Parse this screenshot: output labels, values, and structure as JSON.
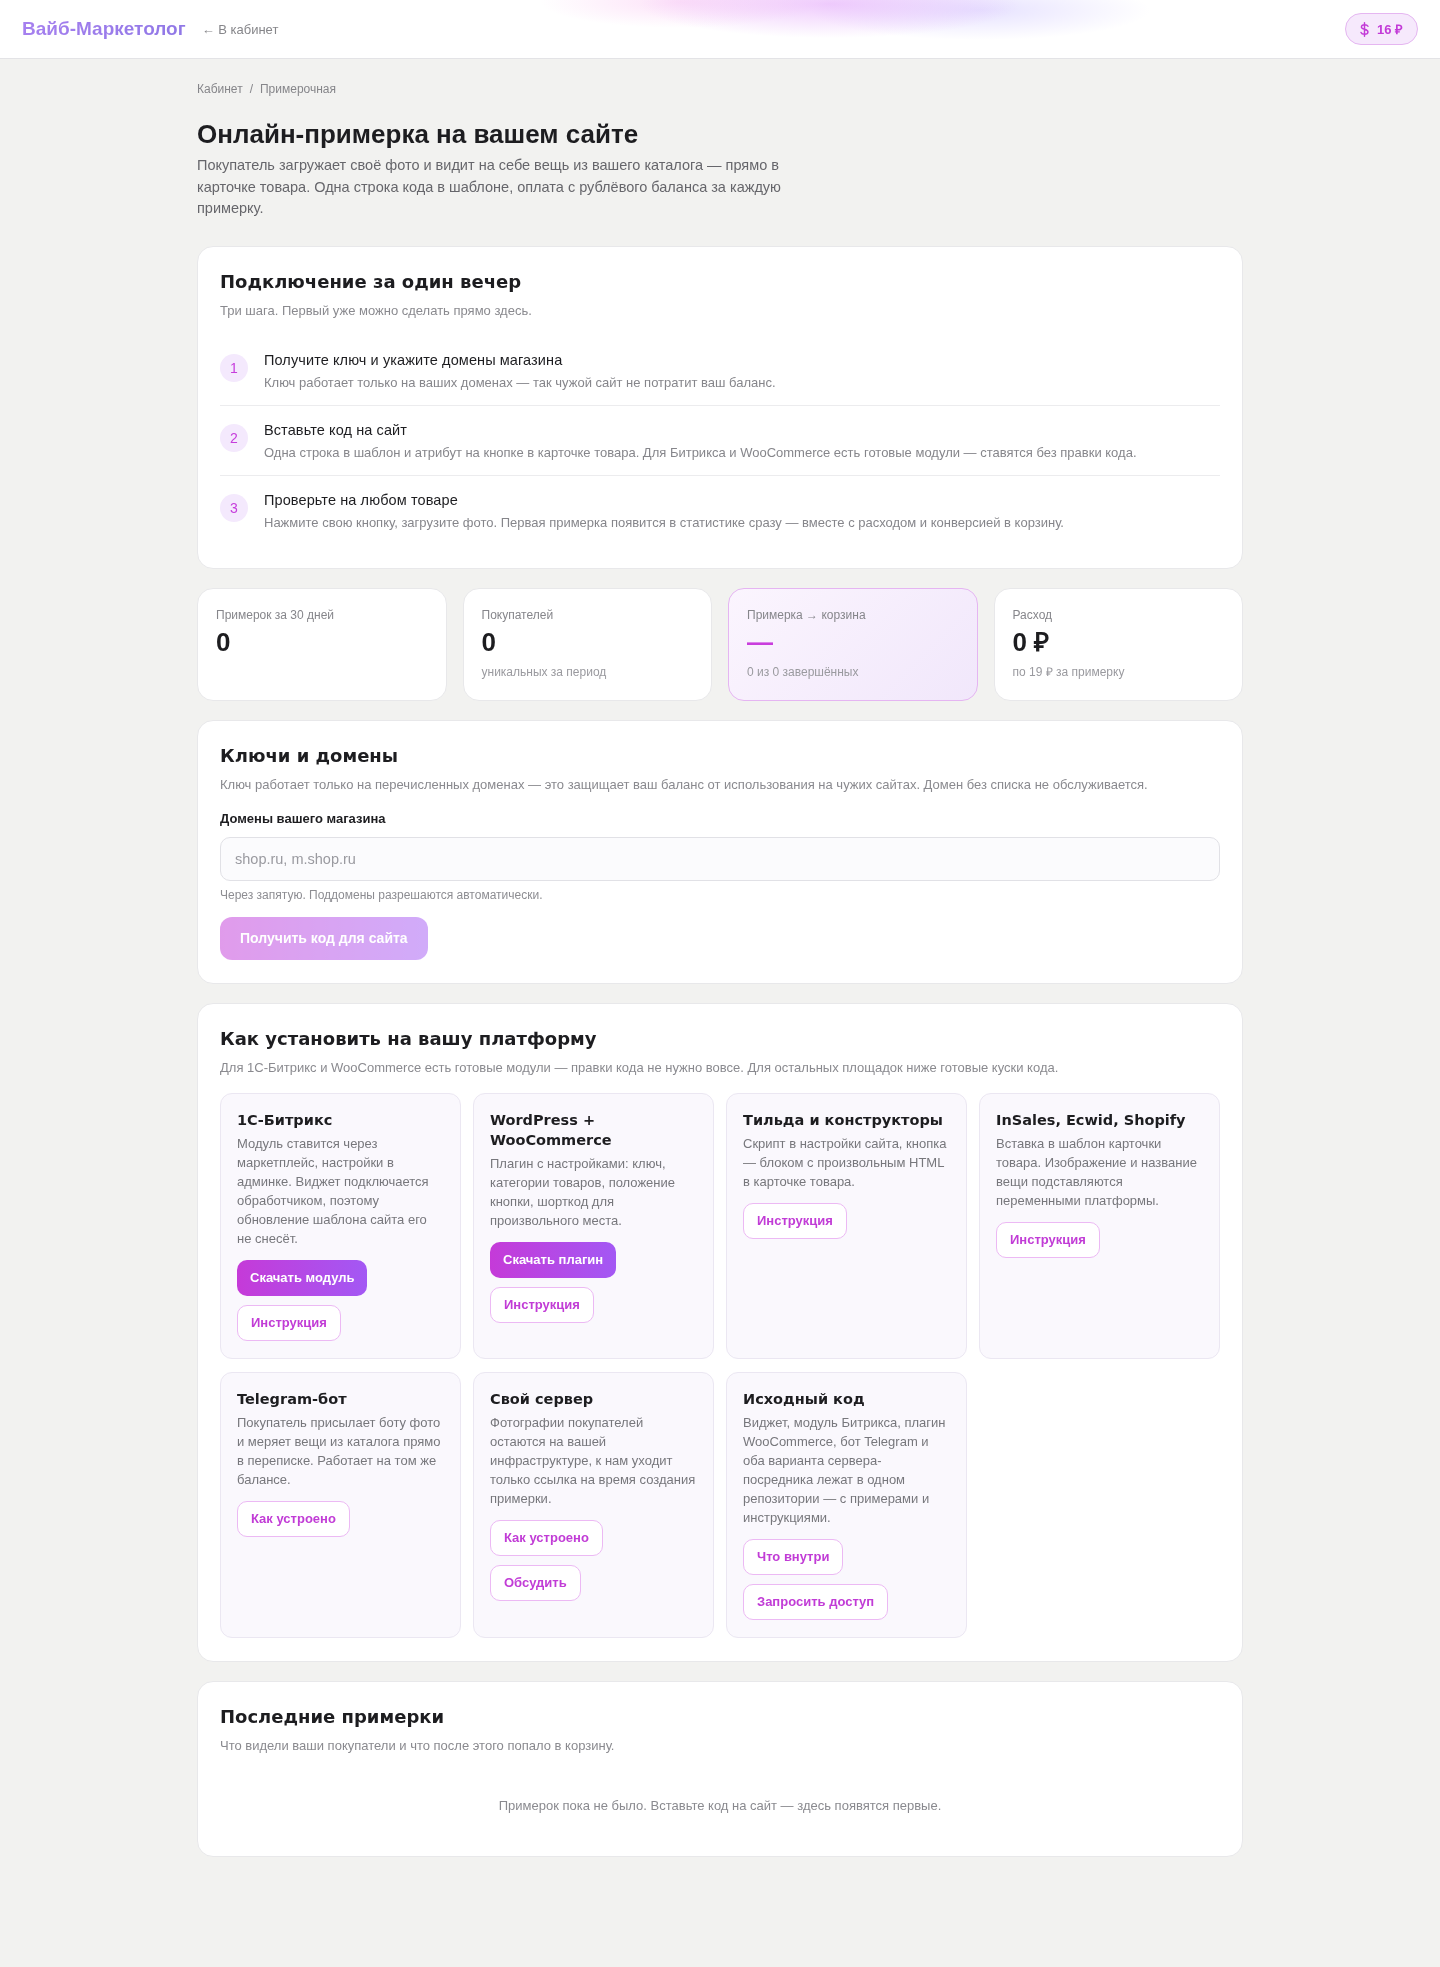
{
  "header": {
    "logo": "Вайб-Маркетолог",
    "back_link": "← В кабинет",
    "balance": "16 ₽"
  },
  "breadcrumb": {
    "items": [
      "Кабинет",
      "Примерочная"
    ],
    "separator": "/"
  },
  "page": {
    "title": "Онлайн-примерка на вашем сайте",
    "description": "Покупатель загружает своё фото и видит на себе вещь из вашего каталога — прямо в карточке товара. Одна строка кода в шаблоне, оплата с рублёвого баланса за каждую примерку."
  },
  "setup": {
    "title": "Подключение за один вечер",
    "subtitle": "Три шага. Первый уже можно сделать прямо здесь.",
    "steps": [
      {
        "number": "1",
        "title": "Получите ключ и укажите домены магазина",
        "text": "Ключ работает только на ваших доменах — так чужой сайт не потратит ваш баланс."
      },
      {
        "number": "2",
        "title": "Вставьте код на сайт",
        "text": "Одна строка в шаблон и атрибут на кнопке в карточке товара. Для Битрикса и WooCommerce есть готовые модули — ставятся без правки кода."
      },
      {
        "number": "3",
        "title": "Проверьте на любом товаре",
        "text": "Нажмите свою кнопку, загрузите фото. Первая примерка появится в статистике сразу — вместе с расходом и конверсией в корзину."
      }
    ]
  },
  "stats": [
    {
      "label": "Примерок за 30 дней",
      "value": "0",
      "highlighted": false
    },
    {
      "label": "Покупателей",
      "value": "0",
      "note": "уникальных за период",
      "highlighted": false
    },
    {
      "label": "Примерка → корзина",
      "value": "—",
      "note": "0 из 0 завершённых",
      "highlighted": true
    },
    {
      "label": "Расход",
      "value": "0 ₽",
      "note": "по 19 ₽ за примерку",
      "highlighted": false
    }
  ],
  "keys": {
    "title": "Ключи и домены",
    "description": "Ключ работает только на перечисленных доменах — это защищает ваш баланс от использования на чужих сайтах. Домен без списка не обслуживается.",
    "field_label": "Домены вашего магазина",
    "field": {
      "placeholder": "shop.ru, m.shop.ru"
    },
    "hint": "Через запятую. Поддомены разрешаются автоматически.",
    "button": {
      "label": "Получить код для сайта",
      "disabled": true
    }
  },
  "platforms": {
    "title": "Как установить на вашу платформу",
    "subtitle": "Для 1С-Битрикс и WooCommerce есть готовые модули — правки кода не нужно вовсе. Для остальных площадок ниже готовые куски кода.",
    "cards": [
      {
        "title": "1С-Битрикс",
        "text": "Модуль ставится через маркетплейс, настройки в админке. Виджет подключается обработчиком, поэтому обновление шаблона сайта его не снесёт.",
        "buttons": [
          {
            "label": "Скачать модуль",
            "kind": "primary"
          },
          {
            "label": "Инструкция",
            "kind": "outline"
          }
        ]
      },
      {
        "title": "WordPress + WooCommerce",
        "text": "Плагин с настройками: ключ, категории товаров, положение кнопки, шорткод для произвольного места.",
        "buttons": [
          {
            "label": "Скачать плагин",
            "kind": "primary"
          },
          {
            "label": "Инструкция",
            "kind": "outline"
          }
        ]
      },
      {
        "title": "Тильда и конструкторы",
        "text": "Скрипт в настройки сайта, кнопка — блоком с произвольным HTML в карточке товара.",
        "buttons": [
          {
            "label": "Инструкция",
            "kind": "outline"
          }
        ]
      },
      {
        "title": "InSales, Ecwid, Shopify",
        "text": "Вставка в шаблон карточки товара. Изображение и название вещи подставляются переменными платформы.",
        "buttons": [
          {
            "label": "Инструкция",
            "kind": "outline"
          }
        ]
      },
      {
        "title": "Telegram-бот",
        "text": "Покупатель присылает боту фото и меряет вещи из каталога прямо в переписке. Работает на том же балансе.",
        "buttons": [
          {
            "label": "Как устроено",
            "kind": "outline"
          }
        ]
      },
      {
        "title": "Свой сервер",
        "text": "Фотографии покупателей остаются на вашей инфраструктуре, к нам уходит только ссылка на время создания примерки.",
        "buttons": [
          {
            "label": "Как устроено",
            "kind": "outline"
          },
          {
            "label": "Обсудить",
            "kind": "outline"
          }
        ]
      },
      {
        "title": "Исходный код",
        "text": "Виджет, модуль Битрикса, плагин WooCommerce, бот Telegram и оба варианта сервера-посредника лежат в одном репозитории — с примерами и инструкциями.",
        "buttons": [
          {
            "label": "Что внутри",
            "kind": "outline"
          },
          {
            "label": "Запросить доступ",
            "kind": "outline"
          }
        ]
      }
    ]
  },
  "recent": {
    "title": "Последние примерки",
    "subtitle": "Что видели ваши покупатели и что после этого попало в корзину.",
    "empty_message": "Примерок пока не было. Вставьте код на сайт — здесь появятся первые."
  }
}
